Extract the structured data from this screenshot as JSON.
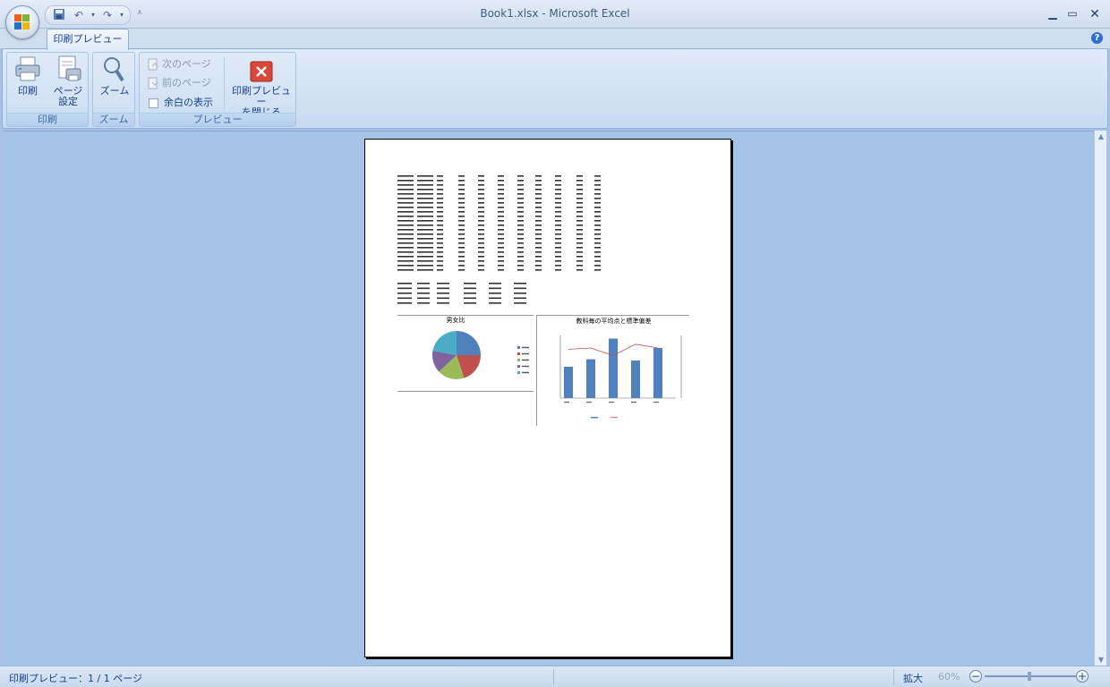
{
  "window": {
    "title": "Book1.xlsx - Microsoft Excel",
    "minimize_icon": "minimize-icon",
    "maximize_icon": "maximize-icon",
    "close_icon": "close-icon"
  },
  "tabs": {
    "active": "印刷プレビュー"
  },
  "ribbon": {
    "print_group": {
      "label": "印刷",
      "print_button": "印刷",
      "page_setup_line1": "ページ",
      "page_setup_line2": "設定"
    },
    "zoom_group": {
      "label": "ズーム",
      "zoom_button": "ズーム"
    },
    "preview_group": {
      "label": "プレビュー",
      "next_page": "次のページ",
      "prev_page": "前のページ",
      "show_margins": "余白の表示",
      "close_line1": "印刷プレビュー",
      "close_line2": "を閉じる"
    }
  },
  "page_preview": {
    "pie_title": "男女比",
    "bar_title": "教科毎の平均点と標準偏差"
  },
  "chart_data": [
    {
      "type": "pie",
      "title": "男女比",
      "slices": [
        {
          "name": "A",
          "value": 25,
          "color": "#4f81bd"
        },
        {
          "name": "B",
          "value": 20,
          "color": "#c0504d"
        },
        {
          "name": "C",
          "value": 18,
          "color": "#9bbb59"
        },
        {
          "name": "D",
          "value": 15,
          "color": "#8064a2"
        },
        {
          "name": "E",
          "value": 22,
          "color": "#4bacc6"
        }
      ]
    },
    {
      "type": "bar",
      "title": "教科毎の平均点と標準偏差",
      "categories": [
        "1",
        "2",
        "3",
        "4",
        "5"
      ],
      "series": [
        {
          "values": [
            50,
            62,
            95,
            60,
            80
          ],
          "color": "#4f81bd"
        },
        {
          "values": [
            78,
            80,
            68,
            86,
            80
          ],
          "color": "#c0504d"
        }
      ]
    }
  ],
  "statusbar": {
    "left": "印刷プレビュー：1 / 1 ページ",
    "zoom_label": "拡大",
    "zoom_value": "60%"
  }
}
